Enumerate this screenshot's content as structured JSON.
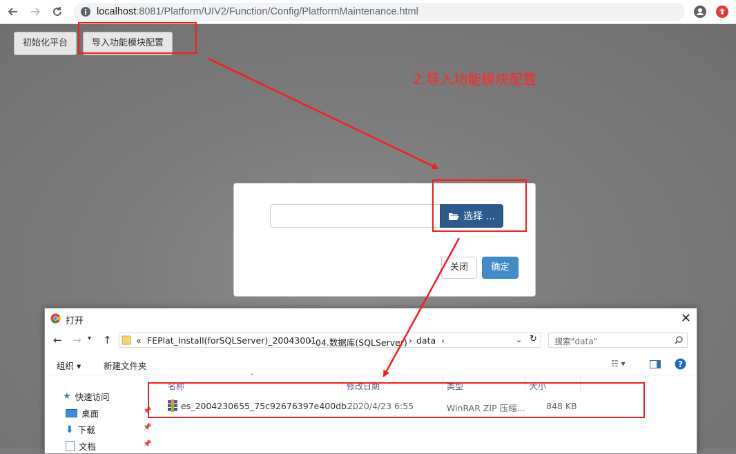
{
  "browser": {
    "url_host": "localhost",
    "url_path": ":8081/Platform/UIV2/Function/Config/PlatformMaintenance.html"
  },
  "toolbar": {
    "init_label": "初始化平台",
    "import_label": "导入功能模块配置"
  },
  "annotation": {
    "step_text": "2.导入功能模块配置"
  },
  "modal": {
    "choose_label": "选择 ...",
    "close_label": "关闭",
    "ok_label": "确定",
    "file_value": ""
  },
  "file_dialog": {
    "title": "打开",
    "breadcrumb": [
      "«",
      "FEPlat_Install(forSQLServer)_20043001",
      "›",
      "04.数据库(SQLServer)",
      "›",
      "data",
      "›"
    ],
    "search_placeholder": "搜索\"data\"",
    "organize_label": "组织 ▾",
    "new_folder_label": "新建文件夹",
    "columns": [
      "名称",
      "修改日期",
      "类型",
      "大小"
    ],
    "sidebar": [
      {
        "label": "快速访问",
        "icon": "star-icon"
      },
      {
        "label": "桌面",
        "icon": "desktop-icon"
      },
      {
        "label": "下载",
        "icon": "download-icon"
      },
      {
        "label": "文档",
        "icon": "document-icon"
      }
    ],
    "files": [
      {
        "name": "es_2004230655_75c92676397e400db...",
        "date": "2020/4/23 6:55",
        "type": "WinRAR ZIP 压缩...",
        "size": "848 KB"
      }
    ]
  },
  "colors": {
    "annotation": "#ff1a1a",
    "choose_button": "#2d5a8c",
    "ok_button": "#428bca"
  }
}
